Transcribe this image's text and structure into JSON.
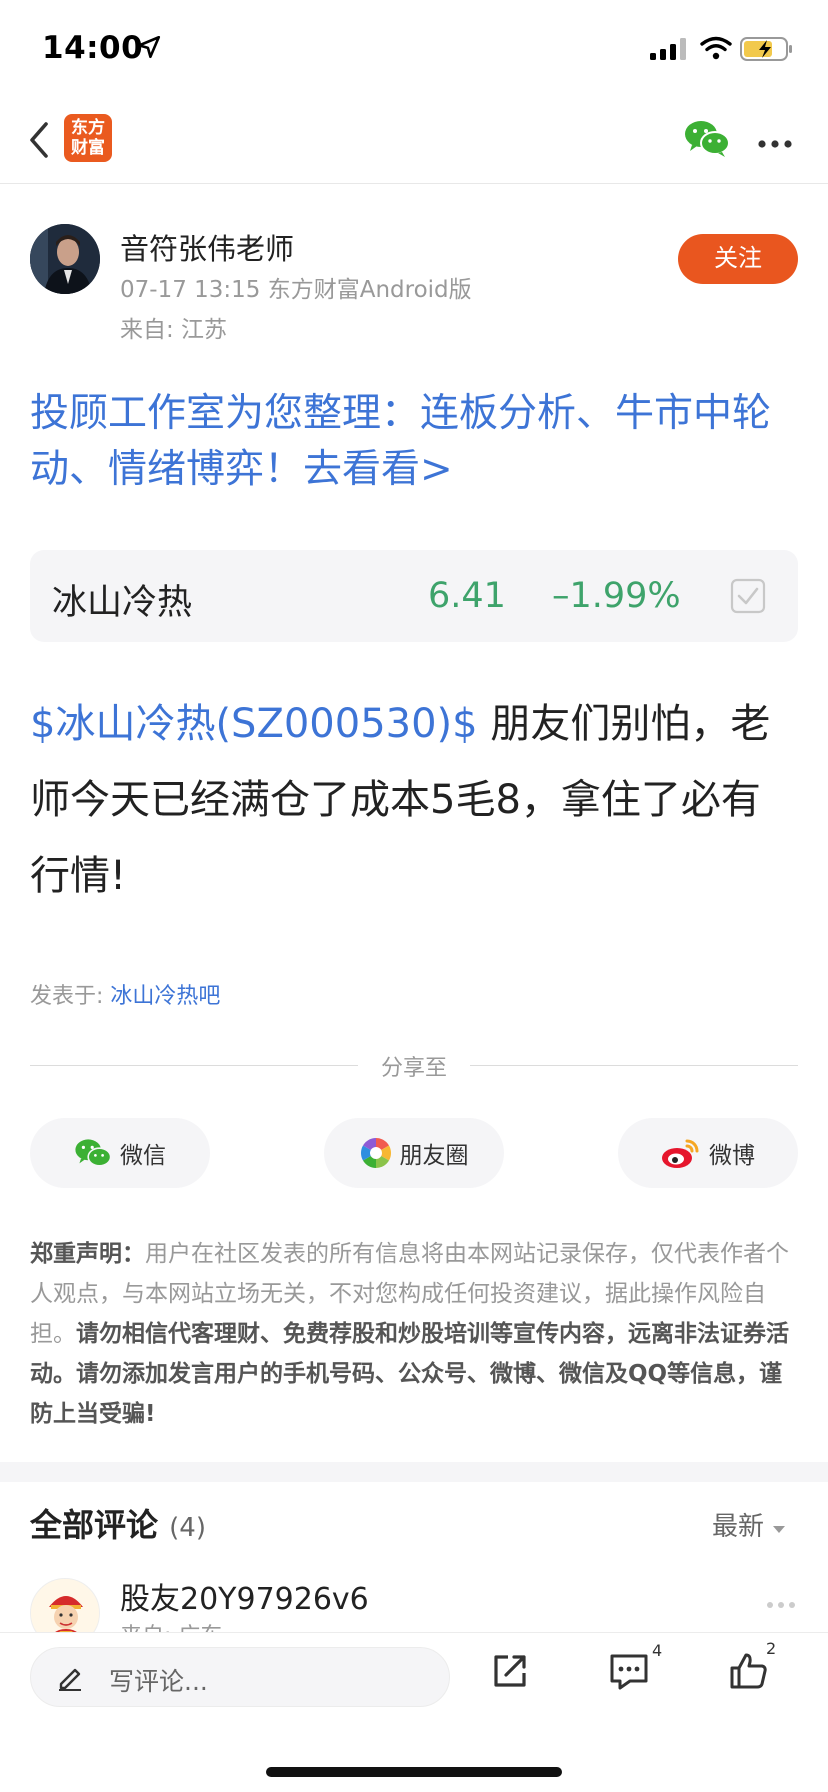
{
  "status_bar": {
    "time": "14:00"
  },
  "nav": {
    "logo_text_1": "东方",
    "logo_text_2": "财富"
  },
  "author": {
    "name": "音符张伟老师",
    "meta": "07-17 13:15 东方财富Android版",
    "location": "来自: 江苏",
    "follow_label": "关注"
  },
  "promo": {
    "text": "投顾工作室为您整理：连板分析、牛市中轮动、情绪博弈！去看看>"
  },
  "stock": {
    "name": "冰山冷热",
    "price": "6.41",
    "change": "–1.99%"
  },
  "post": {
    "stock_tag": "$冰山冷热(SZ000530)$",
    "content": "  朋友们别怕，老师今天已经满仓了成本5毛8，拿住了必有行情!",
    "posted_in_label": "发表于: ",
    "posted_in_link": "冰山冷热吧"
  },
  "share": {
    "label": "分享至",
    "wechat": "微信",
    "moments": "朋友圈",
    "weibo": "微博"
  },
  "disclaimer": {
    "title": "郑重声明：",
    "normal": "用户在社区发表的所有信息将由本网站记录保存，仅代表作者个人观点，与本网站立场无关，不对您构成任何投资建议，据此操作风险自担。",
    "bold": "请勿相信代客理财、免费荐股和炒股培训等宣传内容，远离非法证券活动。请勿添加发言用户的手机号码、公众号、微博、微信及QQ等信息，谨防上当受骗!"
  },
  "comments": {
    "title": "全部评论",
    "count": "(4)",
    "sort_label": "最新",
    "items": [
      {
        "user": "股友20Y97926v6",
        "location": "来自: 广东"
      }
    ]
  },
  "bottom_bar": {
    "input_placeholder": "写评论...",
    "comment_count": "4",
    "like_count": "2"
  },
  "colors": {
    "accent_orange": "#e9561f",
    "link_blue": "#3d74d6",
    "down_green": "#3ea36b"
  }
}
